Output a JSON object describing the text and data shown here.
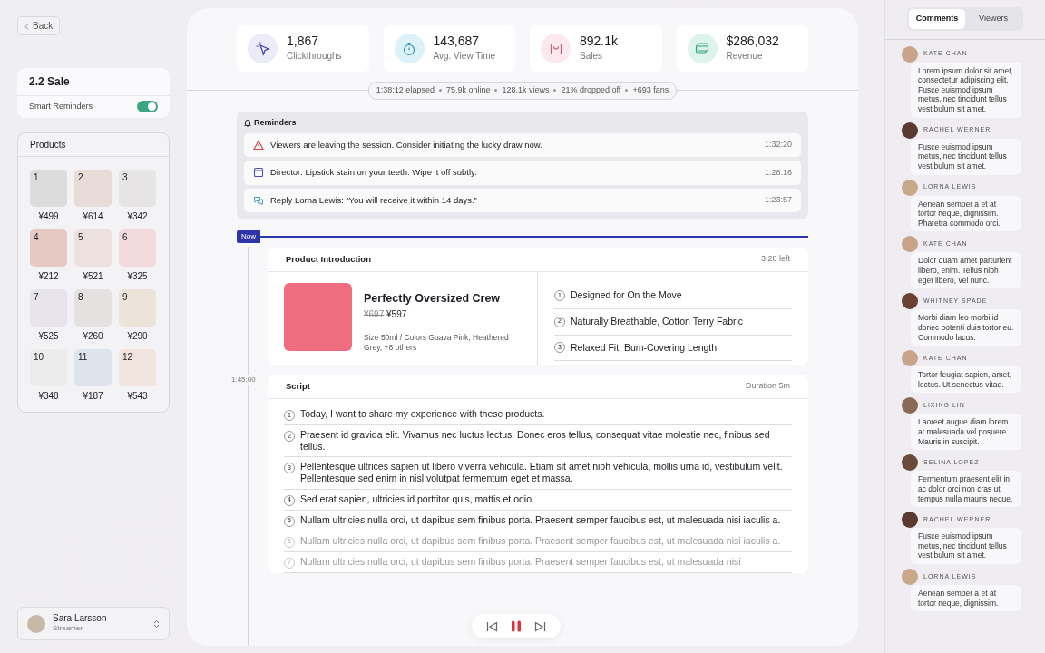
{
  "back_button": {
    "label": "Back"
  },
  "event": {
    "title": "2.2 Sale",
    "smart_reminders": {
      "label": "Smart Reminders",
      "on": true
    }
  },
  "products": {
    "title": "Products",
    "items": [
      {
        "number": "1",
        "price": "¥499"
      },
      {
        "number": "2",
        "price": "¥614"
      },
      {
        "number": "3",
        "price": "¥342"
      },
      {
        "number": "4",
        "price": "¥212"
      },
      {
        "number": "5",
        "price": "¥521"
      },
      {
        "number": "6",
        "price": "¥325"
      },
      {
        "number": "7",
        "price": "¥525"
      },
      {
        "number": "8",
        "price": "¥260"
      },
      {
        "number": "9",
        "price": "¥290"
      },
      {
        "number": "10",
        "price": "¥348"
      },
      {
        "number": "11",
        "price": "¥187"
      },
      {
        "number": "12",
        "price": "¥543"
      }
    ]
  },
  "user": {
    "name": "Sara Larsson",
    "role": "Streamer"
  },
  "stats": [
    {
      "kind": "clicks",
      "value": "1,867",
      "label": "Clickthroughs"
    },
    {
      "kind": "time",
      "value": "143,687",
      "label": "Avg. View Time"
    },
    {
      "kind": "sales",
      "value": "892.1k",
      "label": "Sales"
    },
    {
      "kind": "revenue",
      "value": "$286,032",
      "label": "Revenue"
    }
  ],
  "status_pill": [
    "1:38:12 elapsed",
    "75.9k online",
    "128.1k views",
    "21% dropped off",
    "+693 fans"
  ],
  "reminders": {
    "title": "Reminders",
    "items": [
      {
        "kind": "alert",
        "text": "Viewers are leaving the session. Consider initiating the lucky draw now.",
        "time": "1:32:20"
      },
      {
        "kind": "calendar",
        "text": "Director: Lipstick stain on your teeth. Wipe it off subtly.",
        "time": "1:28:16"
      },
      {
        "kind": "chat",
        "text": "Reply Lorna Lewis: “You will receive it within 14 days.”",
        "time": "1:23:57"
      }
    ]
  },
  "timeline": {
    "now_label": "Now",
    "script_time": "1:45:00"
  },
  "product_intro": {
    "title": "Product Introduction",
    "remaining": "3:28 left",
    "name": "Perfectly Oversized Crew",
    "old_price": "¥697",
    "price": "¥597",
    "details": "Size 50ml / Colors Guava Pink, Heathered Grey, +8 others",
    "points": [
      {
        "number": "1",
        "text": "Designed for On the Move"
      },
      {
        "number": "2",
        "text": "Naturally Breathable, Cotton Terry Fabric"
      },
      {
        "number": "3",
        "text": "Relaxed Fit, Bum-Covering Length"
      }
    ]
  },
  "script": {
    "title": "Script",
    "duration": "Duration 5m",
    "lines": [
      {
        "number": "1",
        "text": "Today, I want to share my experience with these products.",
        "dimmed": false
      },
      {
        "number": "2",
        "text": "Praesent id gravida elit. Vivamus nec luctus lectus. Donec eros tellus, consequat vitae molestie nec, finibus sed tellus.",
        "dimmed": false
      },
      {
        "number": "3",
        "text": "Pellentesque ultrices sapien ut libero viverra vehicula. Etiam sit amet nibh vehicula, mollis urna id, vestibulum velit. Pellentesque sed enim in nisl volutpat fermentum eget et massa.",
        "dimmed": false
      },
      {
        "number": "4",
        "text": "Sed erat sapien, ultricies id porttitor quis, mattis et odio.",
        "dimmed": false
      },
      {
        "number": "5",
        "text": "Nullam ultricies nulla orci, ut dapibus sem finibus porta. Praesent semper faucibus est, ut malesuada nisi iaculis a.",
        "dimmed": false
      },
      {
        "number": "6",
        "text": "Nullam ultricies nulla orci, ut dapibus sem finibus porta. Praesent semper faucibus est, ut malesuada nisi iaculis a.",
        "dimmed": true
      },
      {
        "number": "7",
        "text": "Nullam ultricies nulla orci, ut dapibus sem finibus porta. Praesent semper faucibus est, ut malesuada nisi",
        "dimmed": true
      }
    ]
  },
  "player": {
    "playing": true
  },
  "side_tabs": [
    {
      "label": "Comments",
      "selected": true
    },
    {
      "label": "Viewers",
      "selected": false
    }
  ],
  "comments": [
    {
      "author": "KATE CHAN",
      "text": "Lorem ipsum dolor sit amet, consectetur adipiscing elit. Fusce euismod ipsum metus, nec tincidunt tellus vestibulum sit amet."
    },
    {
      "author": "RACHEL WERNER",
      "text": "Fusce euismod ipsum metus, nec tincidunt tellus vestibulum sit amet."
    },
    {
      "author": "LORNA LEWIS",
      "text": "Aenean semper a et at tortor neque, dignissim. Pharetra commodo orci."
    },
    {
      "author": "KATE CHAN",
      "text": "Dolor quam amet parturient libero, enim. Tellus nibh eget libero, vel nunc."
    },
    {
      "author": "WHITNEY SPADE",
      "text": "Morbi diam leo morbi id donec potenti duis tortor eu. Commodo lacus."
    },
    {
      "author": "KATE CHAN",
      "text": "Tortor feugiat sapien, amet, lectus. Ut senectus vitae."
    },
    {
      "author": "LIXING LIN",
      "text": "Laoreet augue diam lorem at malesuada vel posuere. Mauris in suscipit."
    },
    {
      "author": "SELINA LOPEZ",
      "text": "Fermentum praesent elit in ac dolor orci non cras ut tempus nulla mauris neque."
    },
    {
      "author": "RACHEL WERNER",
      "text": "Fusce euismod ipsum metus, nec tincidunt tellus vestibulum sit amet."
    },
    {
      "author": "LORNA LEWIS",
      "text": "Aenean semper a et at tortor neque, dignissim."
    }
  ]
}
